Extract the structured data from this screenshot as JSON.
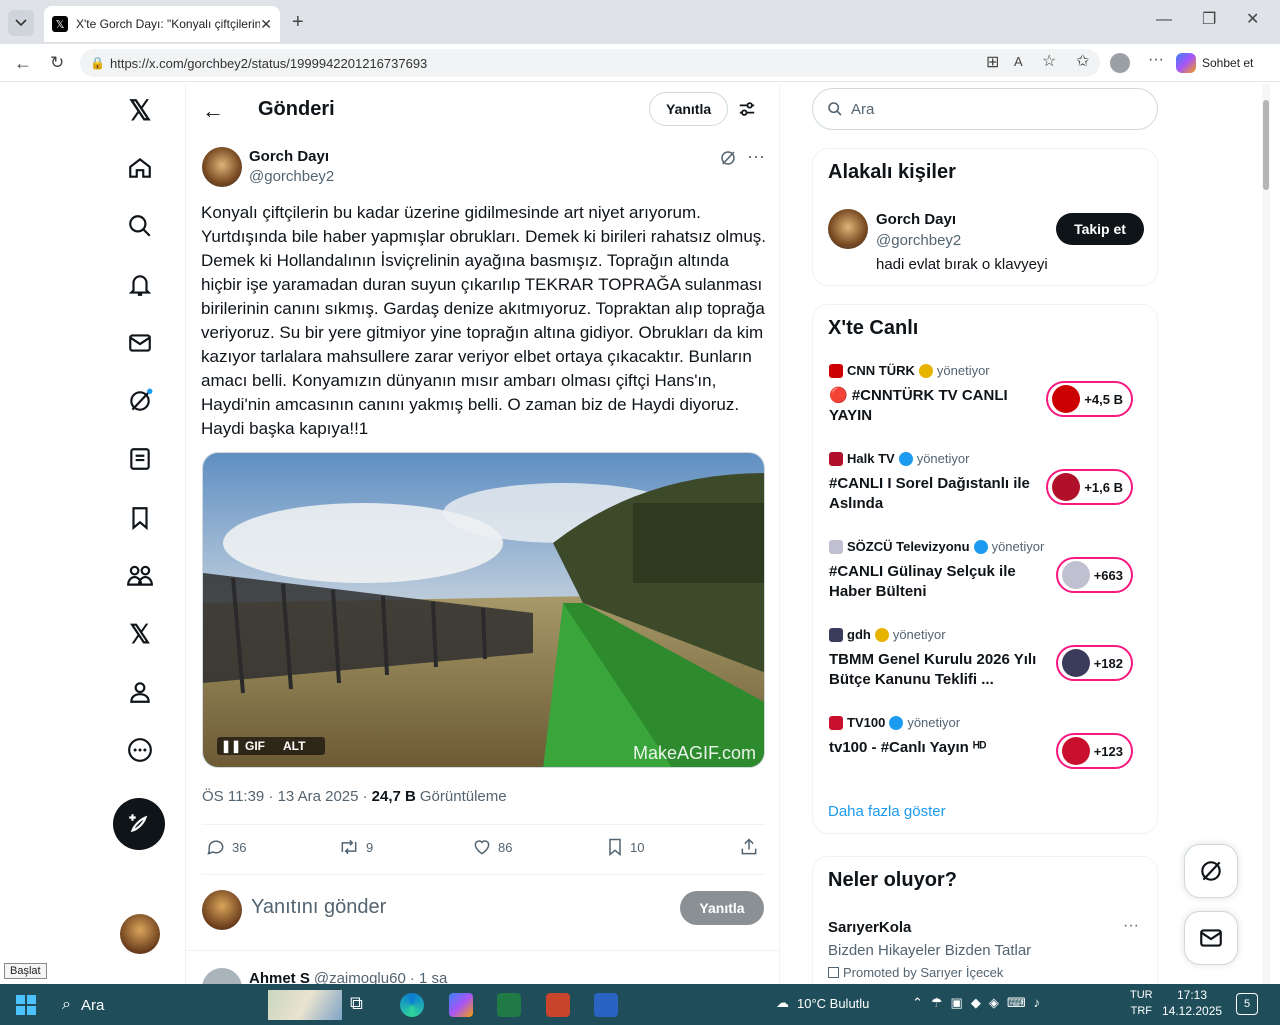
{
  "browser": {
    "tab_title": "X'te Gorch Dayı: \"Konyalı çiftçilerin",
    "url": "https://x.com/gorchbey2/status/1999942201216737693",
    "copilot_label": "Sohbet et"
  },
  "header": {
    "title": "Gönderi",
    "reply_button": "Yanıtla"
  },
  "post": {
    "author_name": "Gorch Dayı",
    "author_handle": "@gorchbey2",
    "text": "Konyalı çiftçilerin bu kadar üzerine gidilmesinde art niyet arıyorum. Yurtdışında bile haber yapmışlar obrukları. Demek ki birileri rahatsız olmuş. Demek ki Hollandalının İsviçrelinin ayağına basmışız. Toprağın altında hiçbir işe yaramadan duran suyun çıkarılıp TEKRAR TOPRAĞA sulanması birilerinin canını sıkmış. Gardaş denize akıtmıyoruz. Topraktan alıp toprağa veriyoruz. Su bir yere gitmiyor yine toprağın altına gidiyor. Obrukları da kim kazıyor tarlalara mahsullere zarar veriyor elbet ortaya çıkacaktır. Bunların amacı belli. Konyamızın dünyanın mısır ambarı olması çiftçi Hans'ın, Haydi'nin amcasının canını yakmış belli. O zaman biz de Haydi diyoruz. Haydi başka kapıya!!1",
    "media_gif_label": "GIF",
    "media_alt_label": "ALT",
    "media_watermark": "MakeAGIF.com",
    "time": "ÖS 11:39 · 13 Ara 2025 ·",
    "views_count": "24,7 B",
    "views_label": "Görüntüleme",
    "replies": "36",
    "reposts": "9",
    "likes": "86",
    "bookmarks": "10"
  },
  "compose": {
    "placeholder": "Yanıtını gönder",
    "button": "Yanıtla"
  },
  "next_reply": {
    "author": "Ahmet S",
    "handle": "@zaimoglu60",
    "time": "· 1 sa"
  },
  "search": {
    "placeholder": "Ara"
  },
  "related": {
    "title": "Alakalı kişiler",
    "name": "Gorch Dayı",
    "handle": "@gorchbey2",
    "bio": "hadi evlat bırak o klavyeyi",
    "follow": "Takip et"
  },
  "live": {
    "title": "X'te Canlı",
    "hosting": "yönetiyor",
    "items": [
      {
        "source": "CNN TÜRK",
        "title": "🔴 #CNNTÜRK TV CANLI YAYIN",
        "count": "+4,5 B",
        "color": "#cc0000",
        "verified": "#e8b400"
      },
      {
        "source": "Halk TV",
        "title": "#CANLI I Sorel Dağıstanlı ile Aslında",
        "count": "+1,6 B",
        "color": "#b0102a",
        "verified": "#1d9bf0"
      },
      {
        "source": "SÖZCÜ Televizyonu",
        "title": "#CANLI Gülinay Selçuk ile Haber Bülteni",
        "count": "+663",
        "color": "#c0c0d0",
        "verified": "#1d9bf0"
      },
      {
        "source": "gdh",
        "title": "TBMM Genel Kurulu 2026 Yılı Bütçe Kanunu Teklifi ...",
        "count": "+182",
        "color": "#3b3b5c",
        "verified": "#e8b400"
      },
      {
        "source": "TV100",
        "title": "tv100 - #Canlı Yayın ᴴᴰ",
        "count": "+123",
        "color": "#c8102e",
        "verified": "#1d9bf0"
      }
    ],
    "more": "Daha fazla göster"
  },
  "trends": {
    "title": "Neler oluyor?",
    "item_name": "SarıyerKola",
    "item_sub": "Bizden Hikayeler Bizden Tatlar",
    "promoted": "Promoted by Sarıyer İçecek"
  },
  "tooltip": "Başlat",
  "taskbar": {
    "search": "Ara",
    "weather": "10°C  Bulutlu",
    "lang1": "TUR",
    "lang2": "TRF",
    "time": "17:13",
    "date": "14.12.2025",
    "notif": "5"
  }
}
